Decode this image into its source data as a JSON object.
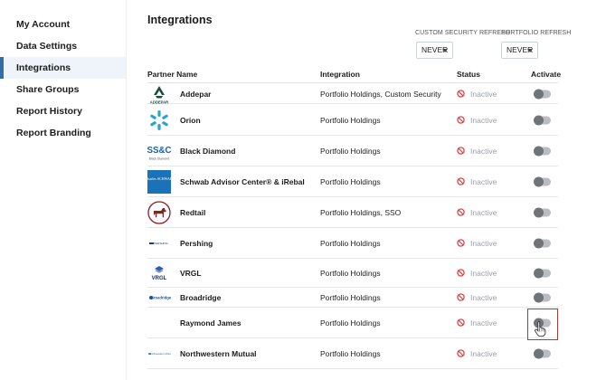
{
  "sidebar": {
    "items": [
      {
        "label": "My Account",
        "active": false
      },
      {
        "label": "Data Settings",
        "active": false
      },
      {
        "label": "Integrations",
        "active": true
      },
      {
        "label": "Share Groups",
        "active": false
      },
      {
        "label": "Report History",
        "active": false
      },
      {
        "label": "Report Branding",
        "active": false
      }
    ]
  },
  "page": {
    "title": "Integrations",
    "custom_refresh": {
      "label": "CUSTOM SECURITY REFRESH",
      "value": "NEVER"
    },
    "portfolio_refresh": {
      "label": "PORTFOLIO REFRESH",
      "value": "NEVER"
    }
  },
  "table": {
    "columns": [
      "Partner Name",
      "Integration",
      "Status",
      "Activate"
    ],
    "rows": [
      {
        "partner": "Addepar",
        "integration": "Portfolio Holdings, Custom Security",
        "status": "Inactive",
        "logo": "addepar-logo",
        "logo_text": "ADDEPAR",
        "active": false
      },
      {
        "partner": "Orion",
        "integration": "Portfolio Holdings",
        "status": "Inactive",
        "logo": "orion-logo",
        "active": false
      },
      {
        "partner": "Black Diamond",
        "integration": "Portfolio Holdings",
        "status": "Inactive",
        "logo": "black-diamond-logo",
        "logo_text": "SS&C",
        "logo_subtext": "Black Diamond",
        "active": false
      },
      {
        "partner": "Schwab Advisor Center® & iRebal",
        "integration": "Portfolio Holdings",
        "status": "Inactive",
        "logo": "schwab-logo",
        "logo_text": "charles SCHWAB",
        "active": false
      },
      {
        "partner": "Redtail",
        "integration": "Portfolio Holdings, SSO",
        "status": "Inactive",
        "logo": "redtail-logo",
        "active": false
      },
      {
        "partner": "Pershing",
        "integration": "Portfolio Holdings",
        "status": "Inactive",
        "logo": "pershing-logo",
        "logo_text": "PERSHING",
        "active": false
      },
      {
        "partner": "VRGL",
        "integration": "Portfolio Holdings",
        "status": "Inactive",
        "logo": "vrgl-logo",
        "logo_text": "VRGL",
        "active": false
      },
      {
        "partner": "Broadridge",
        "integration": "Portfolio Holdings",
        "status": "Inactive",
        "logo": "broadridge-logo",
        "logo_text": "Broadridge",
        "active": false
      },
      {
        "partner": "Raymond James",
        "integration": "Portfolio Holdings",
        "status": "Inactive",
        "logo": "",
        "active": false
      },
      {
        "partner": "Northwestern Mutual",
        "integration": "Portfolio Holdings",
        "status": "Inactive",
        "logo": "northwestern-mutual-logo",
        "logo_text": "Northwestern Mutual",
        "active": false
      }
    ]
  },
  "colors": {
    "accent": "#2d6fa6",
    "inactive_icon": "#d23c3c",
    "inactive_text": "#9aa0a6",
    "highlight": "#a43b32"
  }
}
